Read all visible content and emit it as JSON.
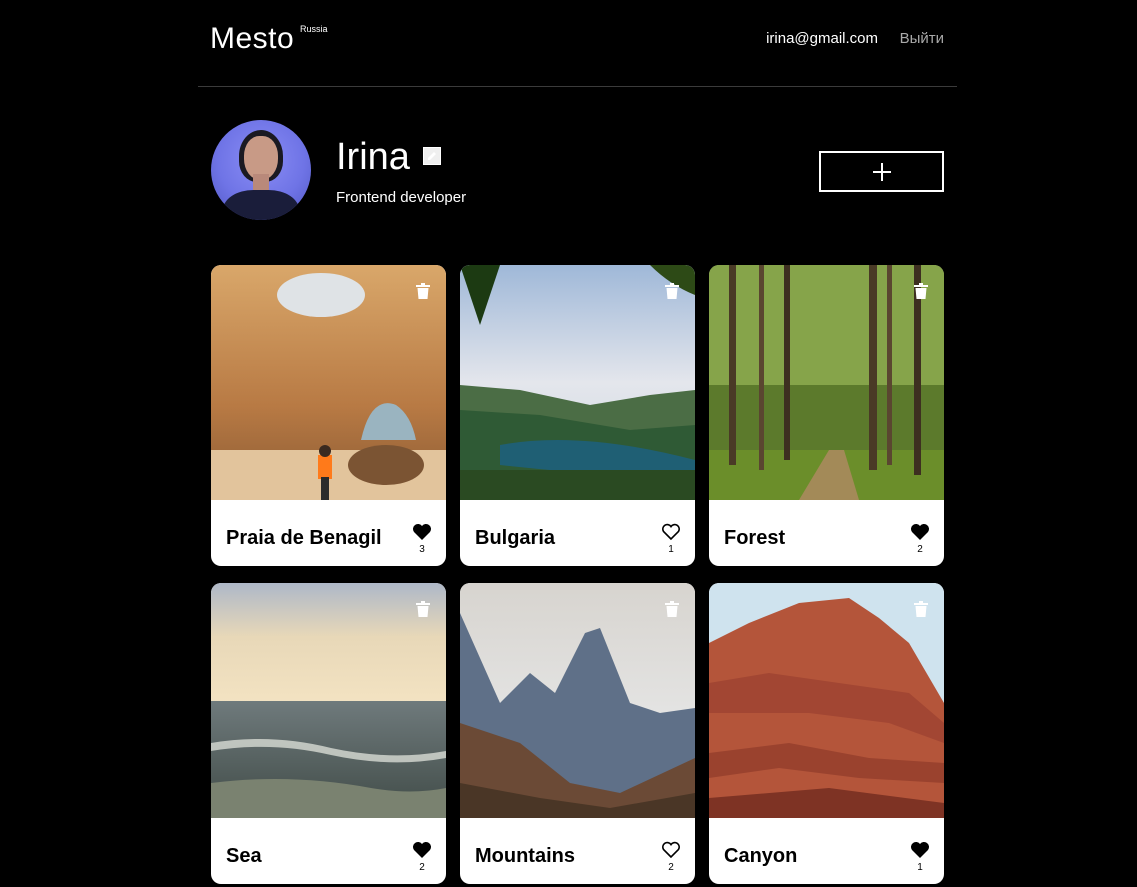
{
  "header": {
    "logo": "Mesto",
    "logo_sup": "Russia",
    "email": "irina@gmail.com",
    "logout": "Выйти"
  },
  "profile": {
    "name": "Irina",
    "about": "Frontend developer",
    "edit_icon": "pencil-icon",
    "add_icon": "plus-icon"
  },
  "cards": [
    {
      "title": "Praia de Benagil",
      "likes": "3",
      "liked": true
    },
    {
      "title": "Bulgaria",
      "likes": "1",
      "liked": false
    },
    {
      "title": "Forest",
      "likes": "2",
      "liked": true
    },
    {
      "title": "Sea",
      "likes": "2",
      "liked": true
    },
    {
      "title": "Mountains",
      "likes": "2",
      "liked": false
    },
    {
      "title": "Canyon",
      "likes": "1",
      "liked": true
    }
  ],
  "colors": {
    "background": "#000000",
    "card": "#ffffff",
    "logout_text": "#a9a9a9"
  }
}
